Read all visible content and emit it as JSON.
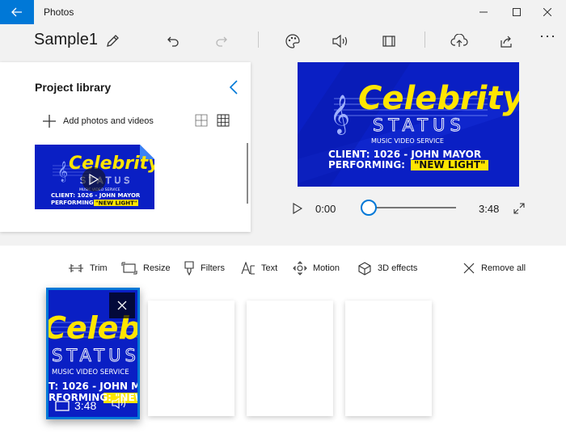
{
  "titlebar": {
    "app_title": "Photos",
    "back_icon": "back-arrow-icon",
    "accent_color": "#0078d7"
  },
  "toolbar": {
    "project_name": "Sample1",
    "icons": [
      "edit-pencil-icon",
      "undo-icon",
      "redo-icon",
      "palette-icon",
      "audio-icon",
      "aspect-ratio-icon",
      "export-upload-icon",
      "share-icon",
      "more-icon"
    ],
    "more_label": "···"
  },
  "library": {
    "title": "Project library",
    "add_label": "Add photos and videos"
  },
  "video": {
    "title_line1": "Celebrity",
    "title_line2": "STATUS",
    "subtitle": "MUSIC VIDEO SERVICE",
    "client_line": "CLIENT: 1026 - JOHN MAYOR",
    "performing_label": "PERFORMING:",
    "song": "\"NEW LIGHT\"",
    "bg_color": "#0a1fc4",
    "title_color": "#ffe500"
  },
  "player": {
    "current_time": "0:00",
    "total_time": "3:48",
    "progress": 0
  },
  "storyboard": {
    "trim": "Trim",
    "resize": "Resize",
    "filters": "Filters",
    "text": "Text",
    "motion": "Motion",
    "effects_3d": "3D effects",
    "remove_all": "Remove all",
    "clip_duration": "3:48",
    "clip_client_line": "T: 1026 - JOHN M",
    "clip_perf_line": "RFORMING: \"NEW L"
  }
}
